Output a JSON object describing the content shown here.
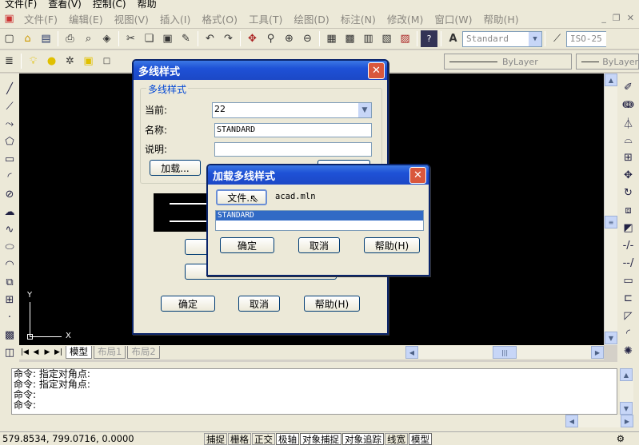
{
  "topmenu": {
    "items": [
      "文件(F)",
      "查看(V)",
      "控制(C)",
      "帮助"
    ]
  },
  "mainmenu": {
    "items": [
      "文件(F)",
      "编辑(E)",
      "视图(V)",
      "插入(I)",
      "格式(O)",
      "工具(T)",
      "绘图(D)",
      "标注(N)",
      "修改(M)",
      "窗口(W)",
      "帮助(H)"
    ]
  },
  "toolbar": {
    "text_style": "Standard",
    "dim_style": "ISO-25",
    "layer_color": "ByLayer",
    "layer_line": "ByLayer"
  },
  "axes": {
    "y": "Y",
    "x": "X"
  },
  "tabs": {
    "items": [
      "模型",
      "布局1",
      "布局2"
    ]
  },
  "command": {
    "lines": [
      "命令: 指定对角点:",
      "命令: 指定对角点:",
      "命令:",
      "命令:"
    ]
  },
  "status": {
    "coords": "579.8534, 799.0716, 0.0000",
    "toggles": [
      "捕捉",
      "栅格",
      "正交",
      "极轴",
      "对象捕捉",
      "对象追踪",
      "线宽",
      "模型"
    ]
  },
  "mline_dialog": {
    "title": "多线样式",
    "group": "多线样式",
    "current_label": "当前:",
    "current_value": "22",
    "name_label": "名称:",
    "name_value": "STANDARD",
    "desc_label": "说明:",
    "desc_value": "",
    "load_button": "加载...",
    "ok": "确定",
    "cancel": "取消",
    "help": "帮助(H)"
  },
  "load_dialog": {
    "title": "加载多线样式",
    "file_button": "文件...",
    "file_name": "acad.mln",
    "list": [
      "STANDARD"
    ],
    "ok": "确定",
    "cancel": "取消",
    "help": "帮助(H)"
  }
}
